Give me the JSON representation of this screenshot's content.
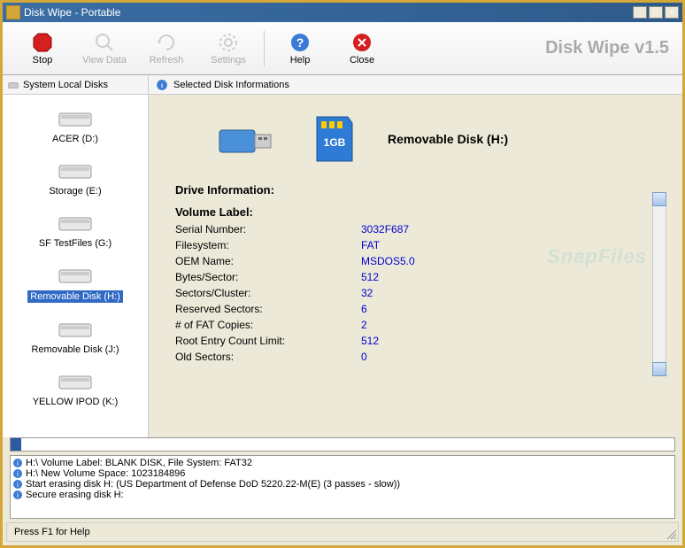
{
  "titlebar": {
    "title": "Disk Wipe  - Portable"
  },
  "toolbar": {
    "stop": "Stop",
    "view_data": "View Data",
    "refresh": "Refresh",
    "settings": "Settings",
    "help": "Help",
    "close": "Close",
    "brand": "Disk Wipe v1.5"
  },
  "sidebar": {
    "header": "System Local Disks",
    "items": [
      {
        "label": "ACER (D:)",
        "type": "hdd"
      },
      {
        "label": "Storage (E:)",
        "type": "hdd"
      },
      {
        "label": "SF TestFiles (G:)",
        "type": "hdd"
      },
      {
        "label": "Removable Disk (H:)",
        "type": "hdd"
      },
      {
        "label": "Removable Disk (J:)",
        "type": "hdd"
      },
      {
        "label": "YELLOW IPOD (K:)",
        "type": "hdd"
      }
    ]
  },
  "main": {
    "header": "Selected Disk Informations",
    "disk_title": "Removable Disk  (H:)",
    "section_title": "Drive Information:",
    "volume_label_title": "Volume Label:",
    "rows": [
      {
        "label": "Serial Number:",
        "value": "3032F687"
      },
      {
        "label": "Filesystem:",
        "value": "FAT"
      },
      {
        "label": "OEM Name:",
        "value": "MSDOS5.0"
      },
      {
        "label": "Bytes/Sector:",
        "value": "512"
      },
      {
        "label": "Sectors/Cluster:",
        "value": "32"
      },
      {
        "label": "Reserved Sectors:",
        "value": "6"
      },
      {
        "label": "# of FAT Copies:",
        "value": "2"
      },
      {
        "label": "Root Entry Count Limit:",
        "value": "512"
      },
      {
        "label": "Old Sectors:",
        "value": "0"
      }
    ]
  },
  "log": [
    "H:\\ Volume Label: BLANK DISK, File System: FAT32",
    "H:\\ New Volume Space: 1023184896",
    "Start erasing disk H: (US Department of Defense DoD 5220.22-M(E) (3 passes - slow))",
    "Secure erasing disk H:"
  ],
  "statusbar": {
    "text": "Press F1 for Help"
  },
  "watermark": "SnapFiles"
}
